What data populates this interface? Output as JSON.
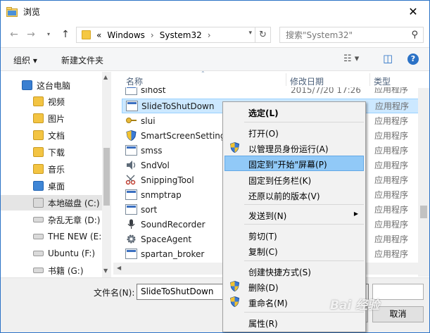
{
  "window": {
    "title": "浏览",
    "close_glyph": "✕"
  },
  "address": {
    "back_glyph": "←",
    "forward_glyph": "→",
    "up_glyph": "↑",
    "chevrons": "«",
    "crumbs": [
      "Windows",
      "System32"
    ],
    "crumb_sep": "›",
    "dropdown_glyph": "▾",
    "refresh_glyph": "↻"
  },
  "search": {
    "placeholder": "搜索\"System32\"",
    "icon": "search-icon",
    "glyph": "⚲"
  },
  "toolbar": {
    "organize_label": "组织 ▾",
    "new_folder_label": "新建文件夹",
    "view_glyph": "☷ ▾",
    "pane_glyph": "◫",
    "help_glyph": "?"
  },
  "nav": {
    "items": [
      {
        "label": "这台电脑",
        "icon": "computer-icon"
      },
      {
        "label": "视频",
        "icon": "video-folder-icon"
      },
      {
        "label": "图片",
        "icon": "pictures-folder-icon"
      },
      {
        "label": "文档",
        "icon": "documents-folder-icon"
      },
      {
        "label": "下载",
        "icon": "downloads-folder-icon"
      },
      {
        "label": "音乐",
        "icon": "music-folder-icon"
      },
      {
        "label": "桌面",
        "icon": "desktop-folder-icon"
      },
      {
        "label": "本地磁盘 (C:)",
        "icon": "windows-drive-icon"
      },
      {
        "label": "杂乱无章 (D:)",
        "icon": "drive-icon"
      },
      {
        "label": "THE NEW (E:)",
        "icon": "drive-icon"
      },
      {
        "label": "Ubuntu (F:)",
        "icon": "drive-icon"
      },
      {
        "label": "书籍 (G:)",
        "icon": "drive-icon"
      }
    ]
  },
  "list": {
    "headers": {
      "name": "名称",
      "date": "修改日期",
      "type": "类型"
    },
    "partial_row": {
      "name": "sihost",
      "date": "2015/7/20 17:26",
      "type": "应用程序"
    },
    "rows": [
      {
        "name": "SlideToShutDown",
        "type": "应用程序",
        "icon": "exe-icon"
      },
      {
        "name": "slui",
        "type": "应用程序",
        "icon": "key-icon"
      },
      {
        "name": "SmartScreenSettings",
        "type": "应用程序",
        "icon": "shield-icon"
      },
      {
        "name": "smss",
        "type": "应用程序",
        "icon": "exe-icon"
      },
      {
        "name": "SndVol",
        "type": "应用程序",
        "icon": "speaker-icon"
      },
      {
        "name": "SnippingTool",
        "type": "应用程序",
        "icon": "scissors-icon"
      },
      {
        "name": "snmptrap",
        "type": "应用程序",
        "icon": "exe-icon"
      },
      {
        "name": "sort",
        "type": "应用程序",
        "icon": "exe-icon"
      },
      {
        "name": "SoundRecorder",
        "type": "应用程序",
        "icon": "microphone-icon"
      },
      {
        "name": "SpaceAgent",
        "type": "应用程序",
        "icon": "gear-icon"
      },
      {
        "name": "spartan_broker",
        "type": "应用程序",
        "icon": "exe-icon"
      }
    ]
  },
  "bottom": {
    "filename_label": "文件名(N):",
    "filename_value": "SlideToShutDown",
    "cancel_label": "取消"
  },
  "context_menu": {
    "items": [
      {
        "label": "选定(L)",
        "bold": true
      },
      {
        "label": "打开(O)"
      },
      {
        "label": "以管理员身份运行(A)",
        "shield": true
      },
      {
        "label": "固定到\"开始\"屏幕(P)",
        "highlight": true
      },
      {
        "label": "固定到任务栏(K)"
      },
      {
        "label": "还原以前的版本(V)"
      },
      {
        "label": "发送到(N)",
        "submenu": true
      },
      {
        "label": "剪切(T)"
      },
      {
        "label": "复制(C)"
      },
      {
        "label": "创建快捷方式(S)"
      },
      {
        "label": "删除(D)",
        "shield": true
      },
      {
        "label": "重命名(M)",
        "shield": true
      },
      {
        "label": "属性(R)"
      }
    ],
    "submenu_glyph": "▶"
  },
  "watermark": "Bai 经验",
  "colors": {
    "selection": "#cce8ff",
    "menu_highlight": "#91c9f7",
    "accent": "#2b72c6"
  }
}
